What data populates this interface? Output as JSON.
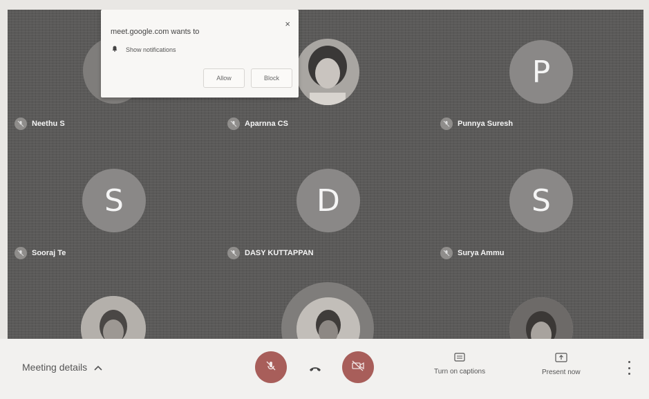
{
  "notification": {
    "title": "meet.google.com wants to",
    "permission": "Show notifications",
    "allow_label": "Allow",
    "block_label": "Block",
    "close_glyph": "×"
  },
  "participants": [
    {
      "name": "Neethu S",
      "initial": ""
    },
    {
      "name": "Aparnna CS",
      "initial": ""
    },
    {
      "name": "Punnya Suresh",
      "initial": "P"
    },
    {
      "name": "Sooraj Te",
      "initial": "S"
    },
    {
      "name": "DASY KUTTAPPAN",
      "initial": "D"
    },
    {
      "name": "Surya Ammu",
      "initial": "S"
    }
  ],
  "bottom_bar": {
    "meeting_details_label": "Meeting details",
    "captions_label": "Turn on captions",
    "present_label": "Present now"
  },
  "colors": {
    "stage_bg": "#5b5a59",
    "control_red": "#a85e5a",
    "avatar_bg": "#8a8887"
  }
}
